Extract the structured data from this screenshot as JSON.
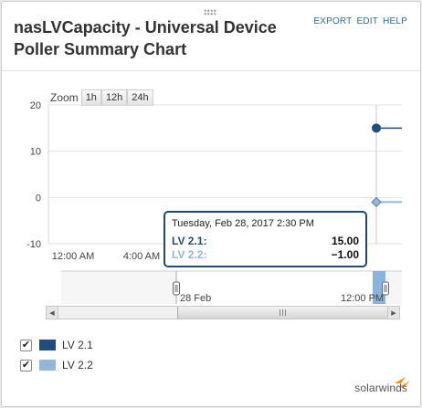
{
  "header": {
    "title": "nasLVCapacity - Universal Device Poller Summary Chart",
    "links": {
      "export": "EXPORT",
      "edit": "EDIT",
      "help": "HELP"
    }
  },
  "zoom": {
    "label": "Zoom",
    "buttons": [
      "1h",
      "12h",
      "24h"
    ]
  },
  "tooltip": {
    "date": "Tuesday, Feb 28, 2017 2:30 PM",
    "rows": [
      {
        "name": "LV 2.1:",
        "value": "15.00"
      },
      {
        "name": "LV 2.2:",
        "value": "−1.00"
      }
    ]
  },
  "navigator": {
    "labels": [
      "28 Feb",
      "12:00 PM"
    ]
  },
  "legend": {
    "items": [
      {
        "name": "LV 2.1",
        "checked": true,
        "color": "#1f4e7e"
      },
      {
        "name": "LV 2.2",
        "checked": true,
        "color": "#93b7d8"
      }
    ]
  },
  "footer": {
    "logo_text": "solarwinds"
  },
  "chart_data": {
    "type": "line",
    "ylim": [
      -10,
      20
    ],
    "y_ticks": [
      "20",
      "10",
      "0",
      "-10"
    ],
    "x_ticks": [
      "12:00 AM",
      "4:00 AM"
    ],
    "grid": true,
    "series": [
      {
        "name": "LV 2.1",
        "color": "#1f4e7e",
        "values": [
          15
        ]
      },
      {
        "name": "LV 2.2",
        "color": "#93b7d8",
        "values": [
          -1
        ]
      }
    ]
  }
}
